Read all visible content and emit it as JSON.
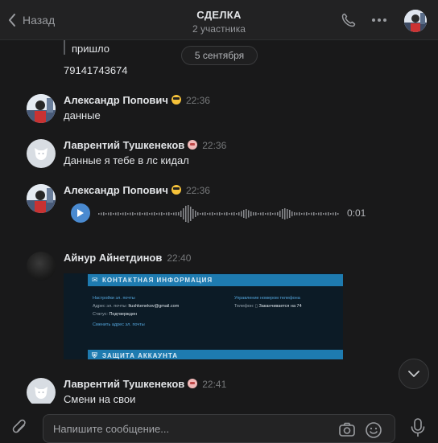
{
  "header": {
    "back_label": "Назад",
    "title": "СДЕЛКА",
    "subtitle": "2 участника"
  },
  "feed": {
    "prev_quote_text": "пришло",
    "prev_text": "79141743674",
    "date_separator": "5 сентября",
    "messages": [
      {
        "author": "Александр Попович",
        "emoji": "cool-face",
        "time": "22:36",
        "text": "данные"
      },
      {
        "author": "Лаврентий Тушкенеков",
        "emoji": "skull-face",
        "time": "22:36",
        "text": "Данные я тебе в лс кидал"
      },
      {
        "author": "Александр Попович",
        "emoji": "cool-face",
        "time": "22:36",
        "voice_duration": "0:01"
      },
      {
        "author": "Айнур Айнетдинов",
        "time": "22:40",
        "attachment": "screenshot"
      },
      {
        "author": "Лаврентий Тушкенеков",
        "emoji": "skull-face",
        "time": "22:41",
        "text": "Смени на свои"
      }
    ]
  },
  "screenshot": {
    "bar1": "КОНТАКТНАЯ ИНФОРМАЦИЯ",
    "left_title": "Настройки эл. почты",
    "email_label": "Адрес эл. почты:",
    "email_value": "ltushkenekov@gmail.com",
    "status_label": "Статус:",
    "status_value": "Подтвержден",
    "change_email": "Сменить адрес эл. почты",
    "right_title": "Управление номером телефона",
    "phone_label": "Телефон:",
    "phone_value": "Заканчивается на 74",
    "bar2": "ЗАЩИТА АККАУНТА"
  },
  "composer": {
    "placeholder": "Напишите сообщение..."
  },
  "colors": {
    "background": "#19191a",
    "accent": "#4a8ad0",
    "text": "#e1e3e6",
    "muted": "#76787a"
  }
}
